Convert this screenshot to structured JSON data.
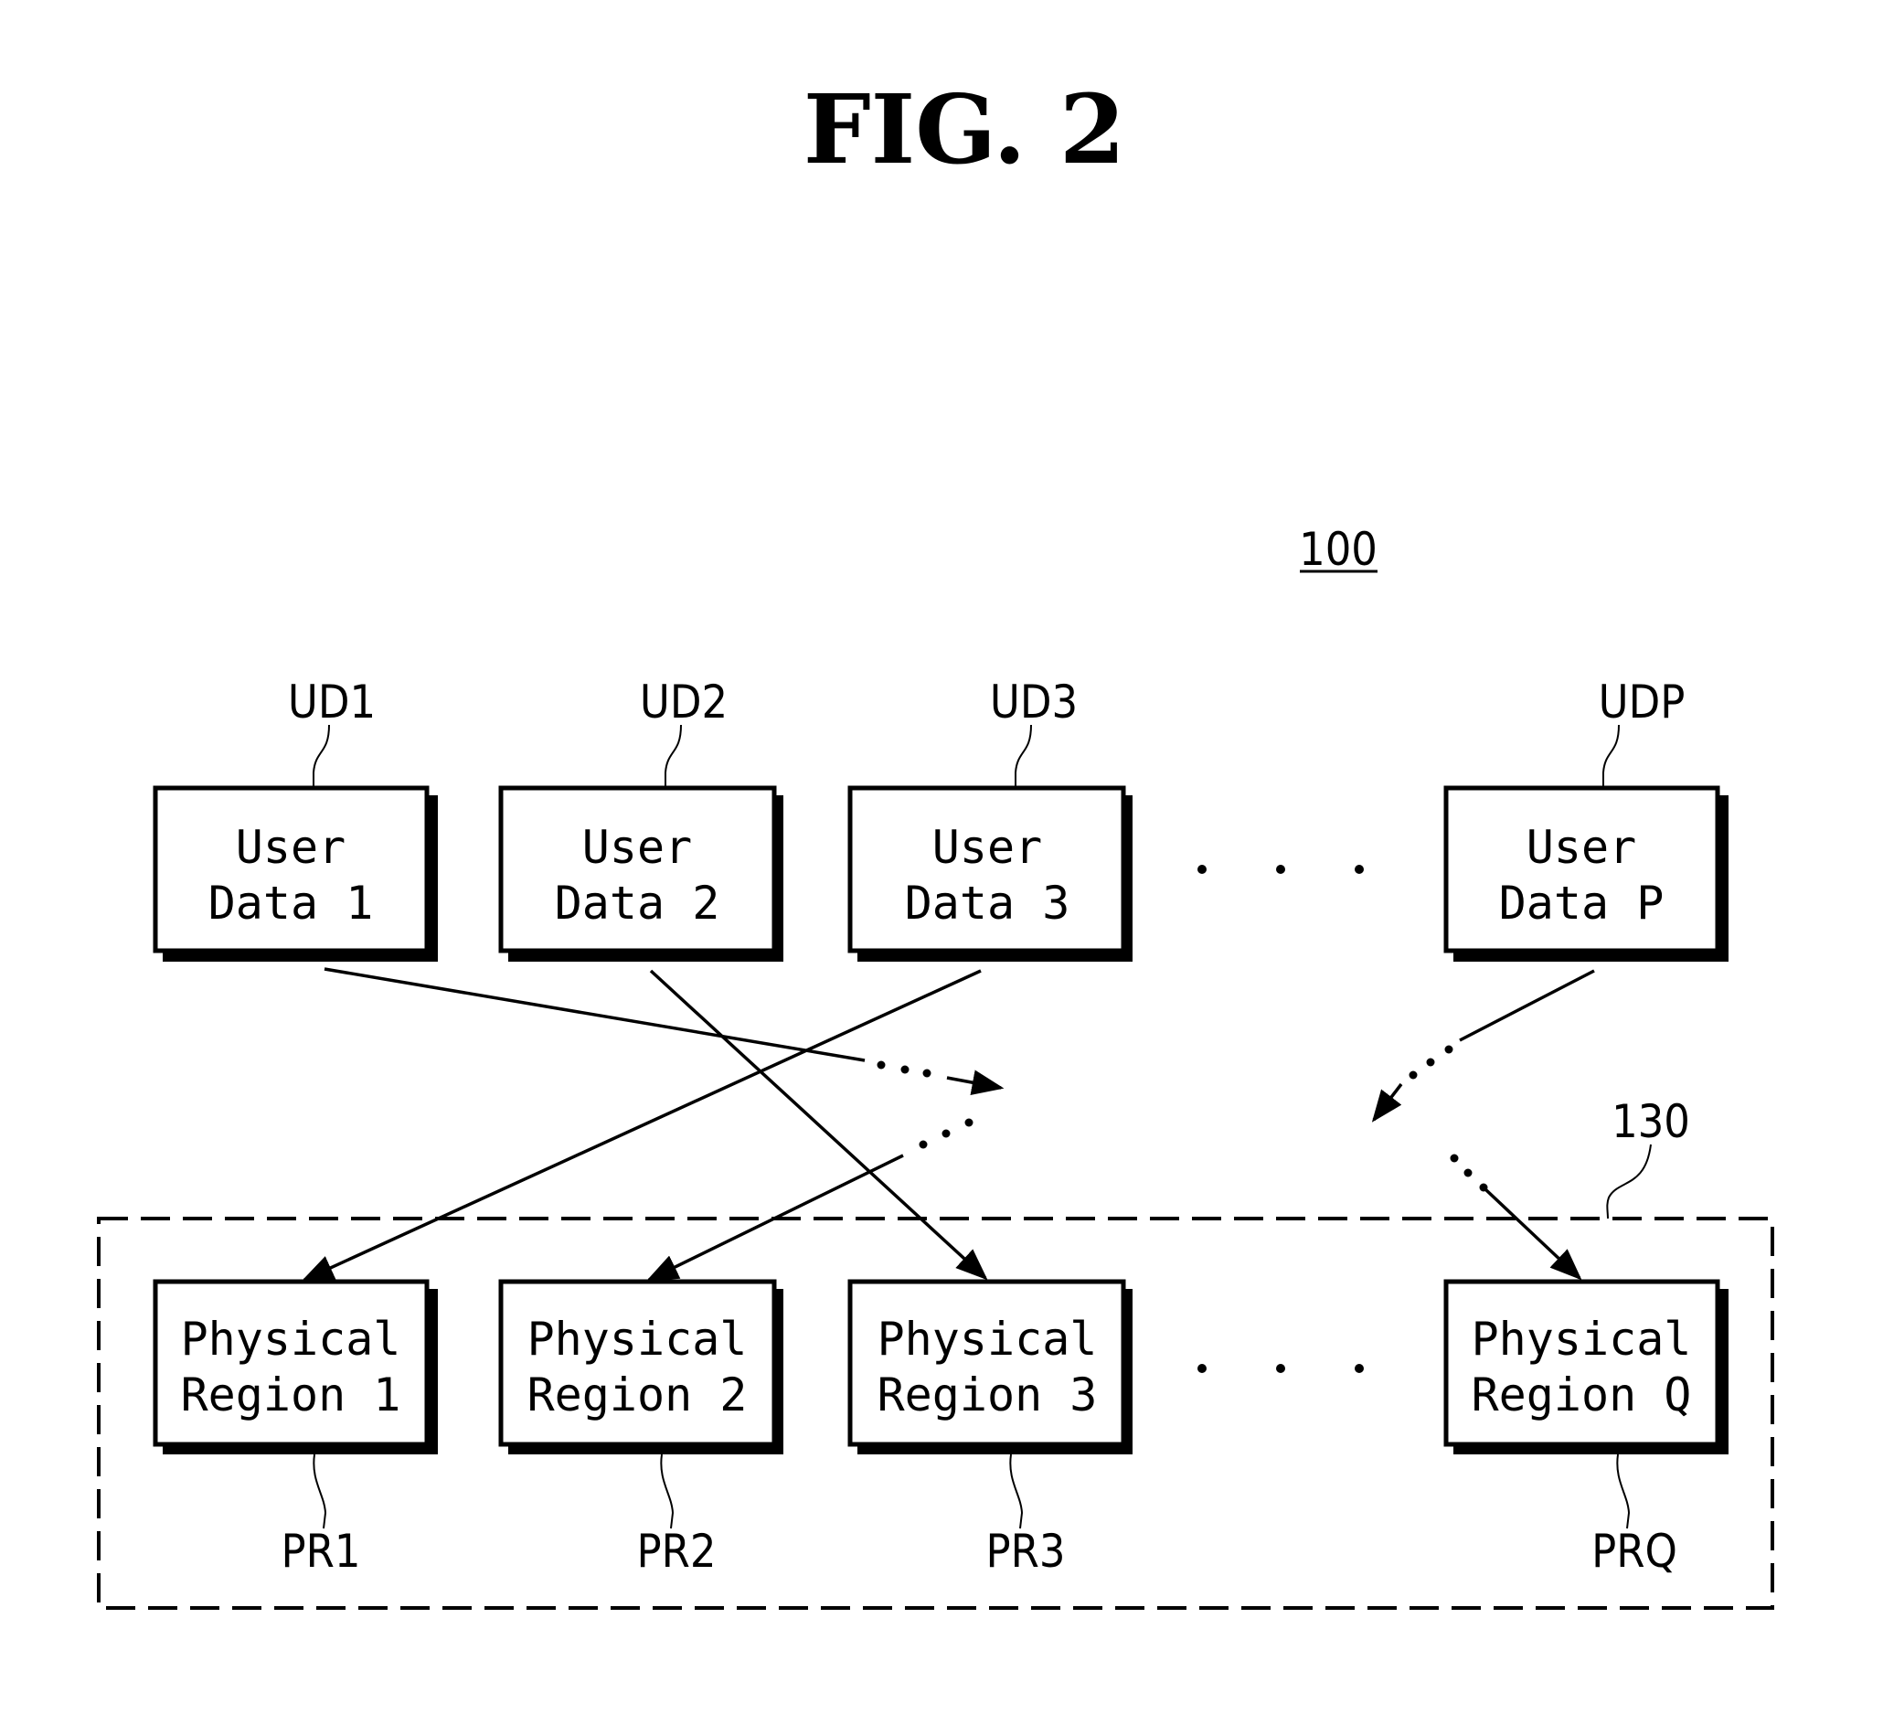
{
  "figure": {
    "title": "FIG. 2",
    "reference": "100",
    "group_reference": "130"
  },
  "user_data": [
    {
      "ref": "UD1",
      "line1": "User",
      "line2": "Data 1"
    },
    {
      "ref": "UD2",
      "line1": "User",
      "line2": "Data 2"
    },
    {
      "ref": "UD3",
      "line1": "User",
      "line2": "Data 3"
    },
    {
      "ref": "UDP",
      "line1": "User",
      "line2": "Data P"
    }
  ],
  "physical_regions": [
    {
      "ref": "PR1",
      "line1": "Physical",
      "line2": "Region 1"
    },
    {
      "ref": "PR2",
      "line1": "Physical",
      "line2": "Region 2"
    },
    {
      "ref": "PR3",
      "line1": "Physical",
      "line2": "Region 3"
    },
    {
      "ref": "PRQ",
      "line1": "Physical",
      "line2": "Region Q"
    }
  ],
  "mappings": [
    {
      "from": "UD1",
      "to": "continuation"
    },
    {
      "from": "UD2",
      "to": "PR3"
    },
    {
      "from": "UD3",
      "to": "PR1"
    },
    {
      "from": "UDP",
      "to": "continuation"
    },
    {
      "from": "continuation",
      "to": "PR2"
    },
    {
      "from": "continuation",
      "to": "PRQ"
    }
  ],
  "ellipsis": "· · ·"
}
